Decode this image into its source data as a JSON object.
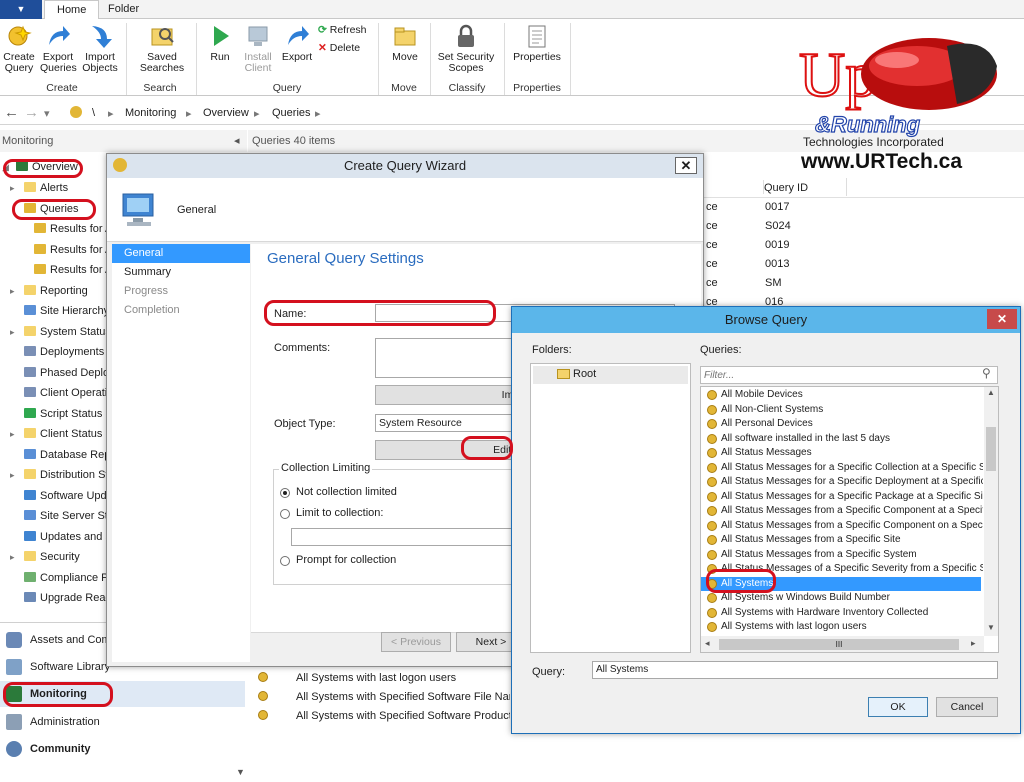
{
  "ribbon": {
    "tabs": [
      "Home",
      "Folder"
    ],
    "buttons": {
      "create_query": "Create\nQuery",
      "export_queries": "Export\nQueries",
      "import_objects": "Import\nObjects",
      "saved_searches": "Saved\nSearches",
      "run": "Run",
      "install_client": "Install\nClient",
      "export": "Export",
      "refresh": "Refresh",
      "delete": "Delete",
      "move": "Move",
      "set_security_scopes": "Set Security\nScopes",
      "properties": "Properties"
    },
    "groups": [
      "Create",
      "Search",
      "Query",
      "Move",
      "Classify",
      "Properties"
    ]
  },
  "address": {
    "path": [
      "\\",
      "Monitoring",
      "Overview",
      "Queries"
    ]
  },
  "nav": {
    "header": "Monitoring",
    "items": [
      {
        "label": "Overview",
        "level": 0
      },
      {
        "label": "Alerts",
        "level": 1
      },
      {
        "label": "Queries",
        "level": 1
      },
      {
        "label": "Results for A",
        "level": 2
      },
      {
        "label": "Results for A",
        "level": 2
      },
      {
        "label": "Results for A",
        "level": 2
      },
      {
        "label": "Reporting",
        "level": 1
      },
      {
        "label": "Site Hierarchy",
        "level": 1
      },
      {
        "label": "System Status",
        "level": 1
      },
      {
        "label": "Deployments",
        "level": 1
      },
      {
        "label": "Phased Deploy",
        "level": 1
      },
      {
        "label": "Client Operati",
        "level": 1
      },
      {
        "label": "Script Status",
        "level": 1
      },
      {
        "label": "Client Status",
        "level": 1
      },
      {
        "label": "Database Repl",
        "level": 1
      },
      {
        "label": "Distribution St",
        "level": 1
      },
      {
        "label": "Software Upda",
        "level": 1
      },
      {
        "label": "Site Server Sta",
        "level": 1
      },
      {
        "label": "Updates and S",
        "level": 1
      },
      {
        "label": "Security",
        "level": 1
      },
      {
        "label": "Compliance Po",
        "level": 1
      },
      {
        "label": "Upgrade Read",
        "level": 1
      }
    ],
    "workspaces": [
      "Assets and Comp",
      "Software Library",
      "Monitoring",
      "Administration",
      "Community"
    ]
  },
  "list": {
    "header": "Queries 40 items",
    "col_query_id": "Query ID",
    "ids": [
      "0017",
      "S024",
      "0019",
      "0013",
      "SM",
      "016"
    ],
    "type_text": "ce",
    "bottom_rows": [
      "All Systems with last logon users",
      "All Systems with Specified Software File Name a",
      "All Systems with Specified Software Product Na"
    ]
  },
  "wizard": {
    "title": "Create Query Wizard",
    "banner": "General",
    "steps": [
      "General",
      "Summary",
      "Progress",
      "Completion"
    ],
    "heading": "General Query Settings",
    "name_label": "Name:",
    "comments_label": "Comments:",
    "import_btn": "Import Qu",
    "object_type_label": "Object Type:",
    "object_type_value": "System Resource",
    "edit_btn": "Edit Que",
    "collection_limiting": "Collection Limiting",
    "radio_not_limited": "Not collection limited",
    "radio_limit": "Limit to collection:",
    "radio_prompt": "Prompt for collection",
    "prev_btn": "< Previous",
    "next_btn": "Next >"
  },
  "browse": {
    "title": "Browse Query",
    "folders_label": "Folders:",
    "root": "Root",
    "queries_label": "Queries:",
    "filter_placeholder": "Filter...",
    "queries": [
      "All Mobile Devices",
      "All Non-Client Systems",
      "All Personal Devices",
      "All software installed in the last 5 days",
      "All Status Messages",
      "All Status Messages for a Specific Collection at a Specific Site",
      "All Status Messages for a Specific Deployment at a Specific Site",
      "All Status Messages for a Specific Package at a Specific Site",
      "All Status Messages from a Specific Component at a Specific Site",
      "All Status Messages from a Specific Component on a Specific Sys",
      "All Status Messages from a Specific Site",
      "All Status Messages from a Specific System",
      "All Status Messages of a Specific Severity from a Specific Source",
      "All Systems",
      "All Systems w Windows Build Number",
      "All Systems with Hardware Inventory Collected",
      "All Systems with last logon users"
    ],
    "selected_index": 13,
    "scroll_thumb": "III",
    "query_label": "Query:",
    "query_value": "All Systems",
    "ok": "OK",
    "cancel": "Cancel"
  },
  "logo": {
    "line1": "Up",
    "line2": "&Running",
    "line3": "Technologies Incorporated",
    "line4": "www.URTech.ca"
  },
  "colors": {
    "highlight": "#d4101e",
    "selection": "#3399ff",
    "dialog_title": "#5bb6ea"
  }
}
